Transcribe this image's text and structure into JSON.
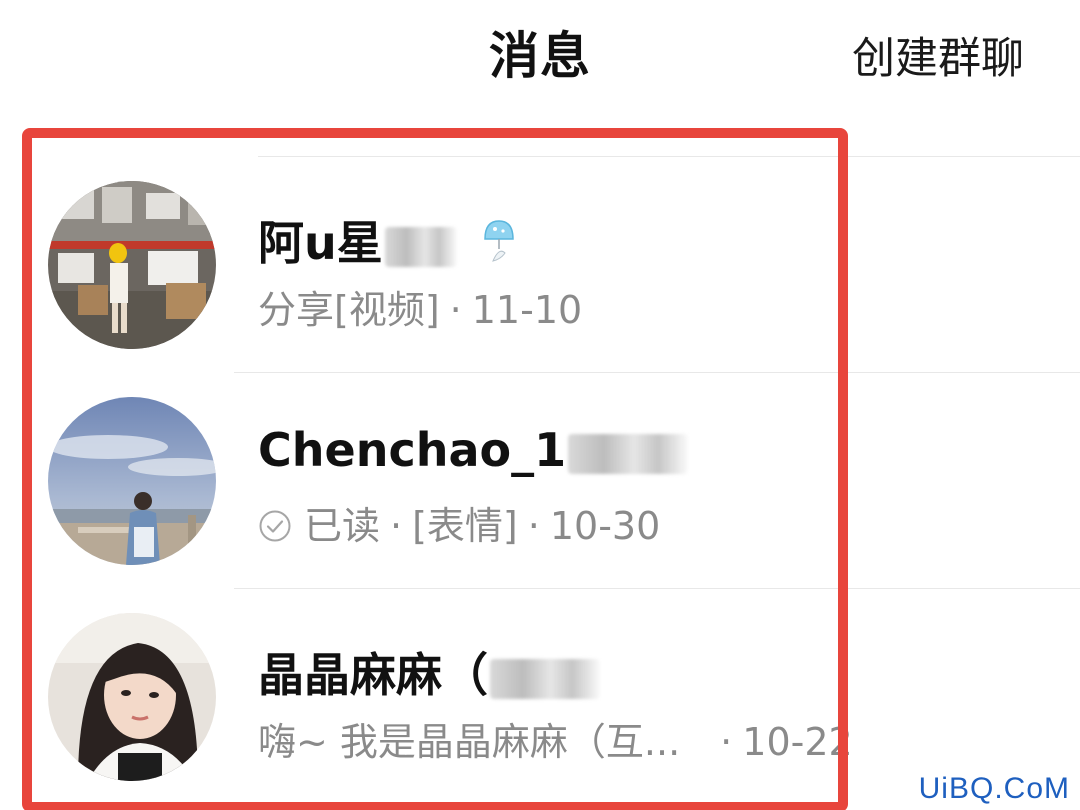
{
  "header": {
    "title": "消息",
    "create_group_label": "创建群聊"
  },
  "conversations": [
    {
      "name": "阿u星",
      "preview": "分享[视频]",
      "time": "11-10",
      "badge_icon": "wind-chime-icon"
    },
    {
      "name": "Chenchao_1",
      "read_status": "已读",
      "preview": "[表情]",
      "time": "10-30"
    },
    {
      "name": "晶晶麻麻（",
      "preview": "嗨~ 我是晶晶麻麻（互...",
      "time": "10-22"
    }
  ],
  "separator": "·",
  "colors": {
    "highlight_frame": "#e8453c",
    "preview_text": "#8a8a8a",
    "watermark": "#1e5fbf"
  },
  "watermark": "UiBQ.CoM"
}
